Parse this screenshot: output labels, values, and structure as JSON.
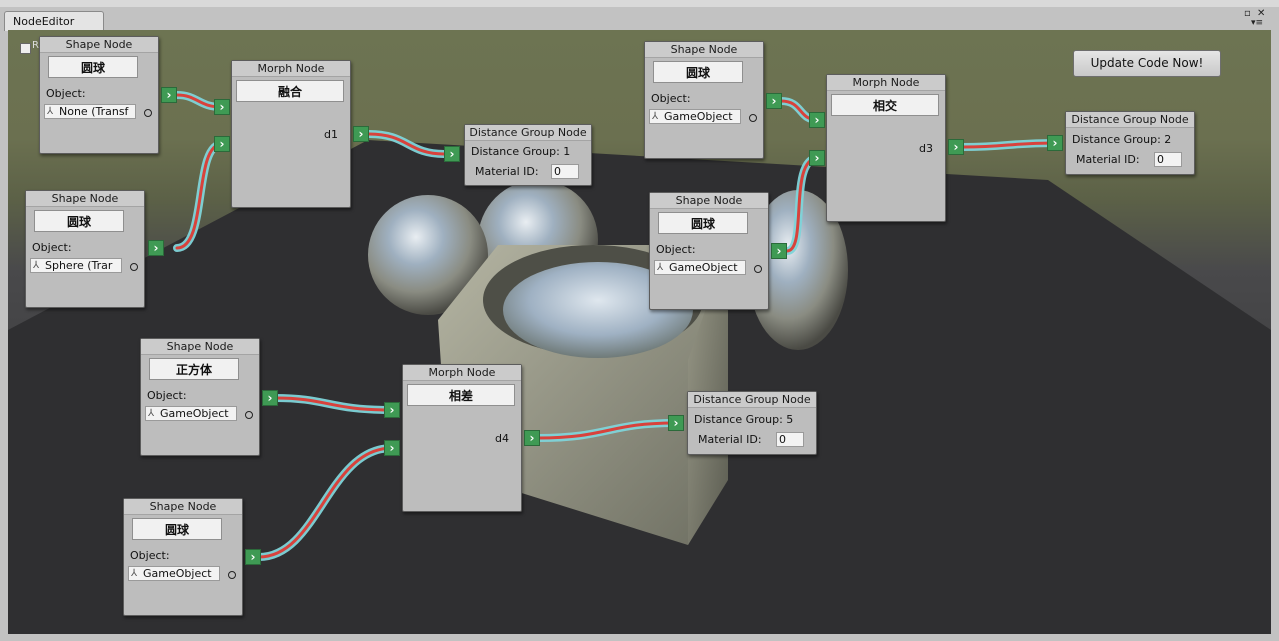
{
  "window": {
    "tab_title": "NodeEditor",
    "controls": {
      "maximize": "▫",
      "close": "✕",
      "menu": "▾≡"
    },
    "checkbox_label": "R"
  },
  "toolbar": {
    "update_button": "Update Code Now!"
  },
  "shape_nodes": [
    {
      "header": "Shape Node",
      "name": "圆球",
      "object_label": "Object:",
      "object_value": "None (Transf"
    },
    {
      "header": "Shape Node",
      "name": "圆球",
      "object_label": "Object:",
      "object_value": "Sphere (Trar"
    },
    {
      "header": "Shape Node",
      "name": "圆球",
      "object_label": "Object:",
      "object_value": "GameObject"
    },
    {
      "header": "Shape Node",
      "name": "圆球",
      "object_label": "Object:",
      "object_value": "GameObject"
    },
    {
      "header": "Shape Node",
      "name": "正方体",
      "object_label": "Object:",
      "object_value": "GameObject"
    },
    {
      "header": "Shape Node",
      "name": "圆球",
      "object_label": "Object:",
      "object_value": "GameObject"
    }
  ],
  "morph_nodes": [
    {
      "header": "Morph Node",
      "name": "融合",
      "output": "d1"
    },
    {
      "header": "Morph Node",
      "name": "相交",
      "output": "d3"
    },
    {
      "header": "Morph Node",
      "name": "相差",
      "output": "d4"
    }
  ],
  "distance_nodes": [
    {
      "header": "Distance Group Node",
      "group_text": "Distance Group: 1",
      "material_label": "Material ID:",
      "material_value": "0"
    },
    {
      "header": "Distance Group Node",
      "group_text": "Distance Group: 2",
      "material_label": "Material ID:",
      "material_value": "0"
    },
    {
      "header": "Distance Group Node",
      "group_text": "Distance Group: 5",
      "material_label": "Material ID:",
      "material_value": "0"
    }
  ],
  "icons": {
    "port": "chevron-right-icon",
    "object": "transform-icon",
    "picker": "circle-picker-icon"
  },
  "colors": {
    "port_green": "#3f9a54",
    "wire_red": "#d8423c",
    "wire_cyan": "#7fd4d9",
    "node_bg": "#bdbdbd"
  }
}
